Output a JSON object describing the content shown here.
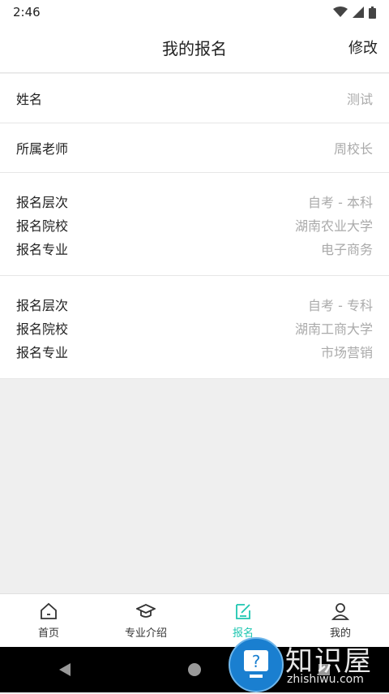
{
  "status": {
    "time": "2:46"
  },
  "header": {
    "title": "我的报名",
    "edit_label": "修改"
  },
  "profile": {
    "name_label": "姓名",
    "name_value": "测试",
    "teacher_label": "所属老师",
    "teacher_value": "周校长"
  },
  "registrations": [
    {
      "level_label": "报名层次",
      "level_value": "自考 - 本科",
      "school_label": "报名院校",
      "school_value": "湖南农业大学",
      "major_label": "报名专业",
      "major_value": "电子商务"
    },
    {
      "level_label": "报名层次",
      "level_value": "自考 - 专科",
      "school_label": "报名院校",
      "school_value": "湖南工商大学",
      "major_label": "报名专业",
      "major_value": "市场营销"
    }
  ],
  "tabs": [
    {
      "label": "首页",
      "icon": "home-icon"
    },
    {
      "label": "专业介绍",
      "icon": "graduation-cap-icon"
    },
    {
      "label": "报名",
      "icon": "edit-icon"
    },
    {
      "label": "我的",
      "icon": "user-icon"
    }
  ],
  "colors": {
    "accent": "#1ec6b0"
  },
  "watermark": {
    "text": "知识屋",
    "sub": "zhishiwu.com"
  }
}
